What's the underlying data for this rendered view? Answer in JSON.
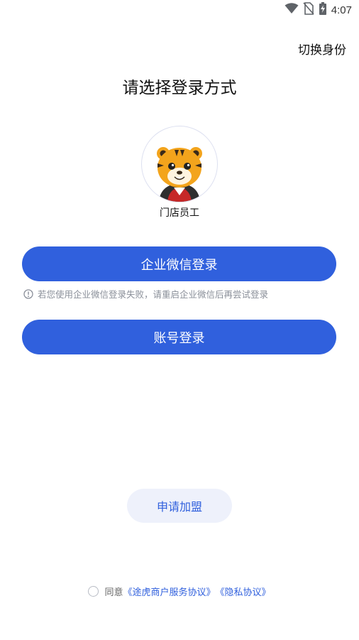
{
  "status_bar": {
    "time": "4:07",
    "icons": [
      "wifi-icon",
      "no-sim-icon",
      "battery-charging-icon"
    ]
  },
  "header": {
    "switch_identity": "切换身份"
  },
  "main": {
    "title": "请选择登录方式",
    "role": {
      "label": "门店员工",
      "avatar": "tiger-mascot-avatar"
    },
    "wecom_login_label": "企业微信登录",
    "hint": {
      "icon": "info-icon",
      "text": "若您使用企业微信登录失败，请重启企业微信后再尝试登录"
    },
    "account_login_label": "账号登录"
  },
  "footer": {
    "join_label": "申请加盟",
    "agree_prefix": "同意",
    "service_agreement": "《途虎商户服务协议》",
    "privacy_agreement": "《隐私协议》"
  },
  "colors": {
    "primary": "#3060dd",
    "join_bg": "#eef1fb",
    "hint_text": "#8a8f99"
  }
}
